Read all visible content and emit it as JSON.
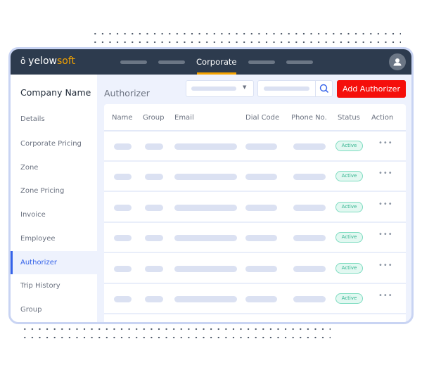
{
  "header": {
    "logo_prefix": "yelow",
    "logo_suffix": "soft",
    "active_nav": "Corporate"
  },
  "sidebar": {
    "title": "Company Name",
    "items": [
      {
        "label": "Details"
      },
      {
        "label": "Corporate Pricing"
      },
      {
        "label": "Zone"
      },
      {
        "label": "Zone Pricing"
      },
      {
        "label": "Invoice"
      },
      {
        "label": "Employee"
      },
      {
        "label": "Authorizer",
        "active": true
      },
      {
        "label": "Trip History"
      },
      {
        "label": "Group"
      }
    ]
  },
  "main": {
    "title": "Authorizer",
    "add_button": "Add Authorizer",
    "columns": [
      "Name",
      "Group",
      "Email",
      "Dial Code",
      "Phone No.",
      "Status",
      "Action"
    ],
    "rows": [
      {
        "status": "Active"
      },
      {
        "status": "Active"
      },
      {
        "status": "Active"
      },
      {
        "status": "Active"
      },
      {
        "status": "Active"
      },
      {
        "status": "Active"
      }
    ],
    "action_glyph": "•••"
  },
  "colors": {
    "header": "#2d3b4e",
    "accent": "#f5a300",
    "primary": "#3563e9",
    "add_button": "#f50f0b",
    "active_badge": "#2fb38e"
  }
}
